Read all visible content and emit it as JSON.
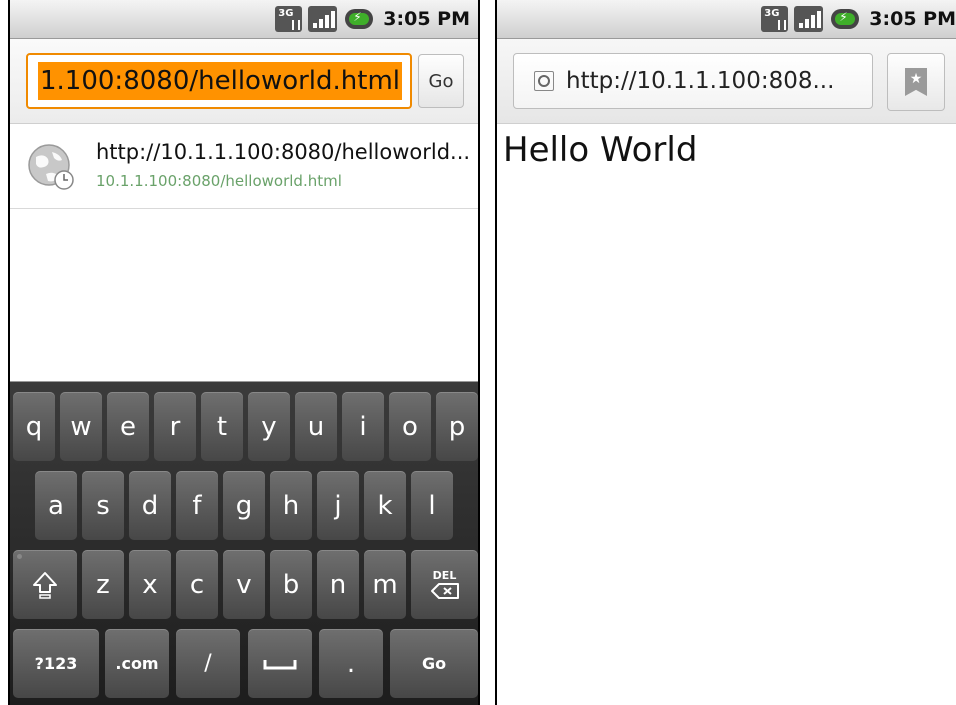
{
  "status_bar": {
    "network": "3G",
    "time": "3:05 PM"
  },
  "left_screen": {
    "url_input_value": "1.100:8080/helloworld.html",
    "go_label": "Go",
    "suggestion": {
      "title": "http://10.1.1.100:8080/helloworld...",
      "url": "10.1.1.100:8080/helloworld.html"
    },
    "keyboard": {
      "row1": [
        "q",
        "w",
        "e",
        "r",
        "t",
        "y",
        "u",
        "i",
        "o",
        "p"
      ],
      "row2": [
        "a",
        "s",
        "d",
        "f",
        "g",
        "h",
        "j",
        "k",
        "l"
      ],
      "row3": [
        "z",
        "x",
        "c",
        "v",
        "b",
        "n",
        "m"
      ],
      "delete_label": "DEL",
      "symbols_label": "?123",
      "dotcom_label": ".com",
      "slash_label": "/",
      "period_label": ".",
      "go_label": "Go"
    }
  },
  "right_screen": {
    "url_text": "http://10.1.1.100:808...",
    "page_heading": "Hello World"
  },
  "colors": {
    "accent_orange": "#ff9200",
    "suggest_url_green": "#6aa26a"
  }
}
